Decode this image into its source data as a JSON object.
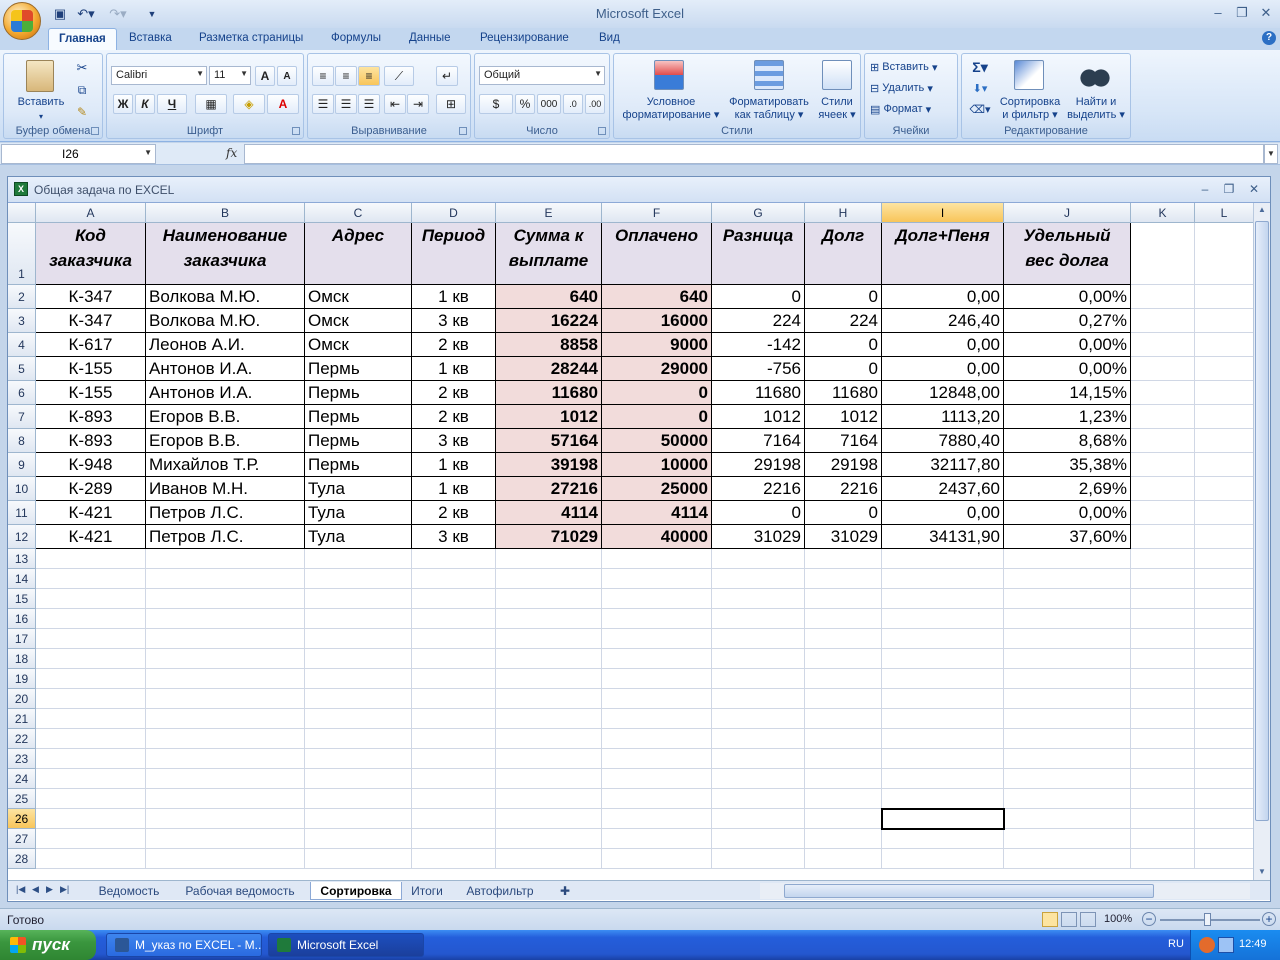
{
  "app": {
    "title": "Microsoft Excel",
    "ribbon_tabs": [
      "Главная",
      "Вставка",
      "Разметка страницы",
      "Формулы",
      "Данные",
      "Рецензирование",
      "Вид"
    ],
    "active_tab": "Главная"
  },
  "ribbon": {
    "clipboard": {
      "paste": "Вставить",
      "label": "Буфер обмена"
    },
    "font": {
      "name": "Calibri",
      "size": "11",
      "bold": "Ж",
      "italic": "К",
      "underline": "Ч",
      "grow": "A",
      "shrink": "A",
      "label": "Шрифт"
    },
    "alignment": {
      "label": "Выравнивание"
    },
    "number": {
      "format": "Общий",
      "percent": "%",
      "thousands": "000",
      "label": "Число"
    },
    "styles": {
      "conditional": [
        "Условное",
        "форматирование"
      ],
      "as_table": [
        "Форматировать",
        "как таблицу"
      ],
      "cell_styles": [
        "Стили",
        "ячеек"
      ],
      "label": "Стили"
    },
    "cells": {
      "insert": "Вставить",
      "delete": "Удалить",
      "format": "Формат",
      "label": "Ячейки"
    },
    "editing": {
      "sigma": "Σ",
      "sort": [
        "Сортировка",
        "и фильтр"
      ],
      "find": [
        "Найти и",
        "выделить"
      ],
      "label": "Редактирование"
    }
  },
  "formula_bar": {
    "name_box": "I26",
    "fx": "fx",
    "value": ""
  },
  "workbook": {
    "title": "Общая задача по EXCEL",
    "columns": [
      "A",
      "B",
      "C",
      "D",
      "E",
      "F",
      "G",
      "H",
      "I",
      "J",
      "K",
      "L"
    ],
    "selected_column": "I",
    "selected_row": "26",
    "header_row": [
      "Код заказчика",
      "Наименование заказчика",
      "Адрес",
      "Период",
      "Сумма к выплате",
      "Оплачено",
      "Разница",
      "Долг",
      "Долг+Пеня",
      "Удельный вес долга"
    ],
    "rows": [
      [
        "К-347",
        "Волкова М.Ю.",
        "Омск",
        "1 кв",
        "640",
        "640",
        "0",
        "0",
        "0,00",
        "0,00%"
      ],
      [
        "К-347",
        "Волкова М.Ю.",
        "Омск",
        "3 кв",
        "16224",
        "16000",
        "224",
        "224",
        "246,40",
        "0,27%"
      ],
      [
        "К-617",
        "Леонов А.И.",
        "Омск",
        "2 кв",
        "8858",
        "9000",
        "-142",
        "0",
        "0,00",
        "0,00%"
      ],
      [
        "К-155",
        "Антонов И.А.",
        "Пермь",
        "1 кв",
        "28244",
        "29000",
        "-756",
        "0",
        "0,00",
        "0,00%"
      ],
      [
        "К-155",
        "Антонов И.А.",
        "Пермь",
        "2 кв",
        "11680",
        "0",
        "11680",
        "11680",
        "12848,00",
        "14,15%"
      ],
      [
        "К-893",
        "Егоров В.В.",
        "Пермь",
        "2 кв",
        "1012",
        "0",
        "1012",
        "1012",
        "1113,20",
        "1,23%"
      ],
      [
        "К-893",
        "Егоров В.В.",
        "Пермь",
        "3 кв",
        "57164",
        "50000",
        "7164",
        "7164",
        "7880,40",
        "8,68%"
      ],
      [
        "К-948",
        "Михайлов Т.Р.",
        "Пермь",
        "1 кв",
        "39198",
        "10000",
        "29198",
        "29198",
        "32117,80",
        "35,38%"
      ],
      [
        "К-289",
        "Иванов М.Н.",
        "Тула",
        "1 кв",
        "27216",
        "25000",
        "2216",
        "2216",
        "2437,60",
        "2,69%"
      ],
      [
        "К-421",
        "Петров Л.С.",
        "Тула",
        "2 кв",
        "4114",
        "4114",
        "0",
        "0",
        "0,00",
        "0,00%"
      ],
      [
        "К-421",
        "Петров Л.С.",
        "Тула",
        "3 кв",
        "71029",
        "40000",
        "31029",
        "31029",
        "34131,90",
        "37,60%"
      ]
    ],
    "row_numbers": [
      "1",
      "2",
      "3",
      "4",
      "5",
      "6",
      "7",
      "8",
      "9",
      "10",
      "11",
      "12",
      "13",
      "14",
      "15",
      "16",
      "17",
      "18",
      "19",
      "20",
      "21",
      "22",
      "23",
      "24",
      "25",
      "26",
      "27",
      "28"
    ],
    "sheet_tabs": [
      "Ведомость",
      "Рабочая ведомость",
      "Сортировка",
      "Итоги",
      "Автофильтр"
    ],
    "active_sheet": "Сортировка"
  },
  "status_bar": {
    "state": "Готово",
    "zoom": "100%"
  },
  "taskbar": {
    "start": "пуск",
    "tasks": [
      "М_указ по EXCEL - М...",
      "Microsoft Excel"
    ],
    "language": "RU",
    "clock": "12:49"
  },
  "colors": {
    "header_fill": "#e4dfec",
    "highlight_fill": "#f2dcdb",
    "selection": "#f8c55a"
  }
}
